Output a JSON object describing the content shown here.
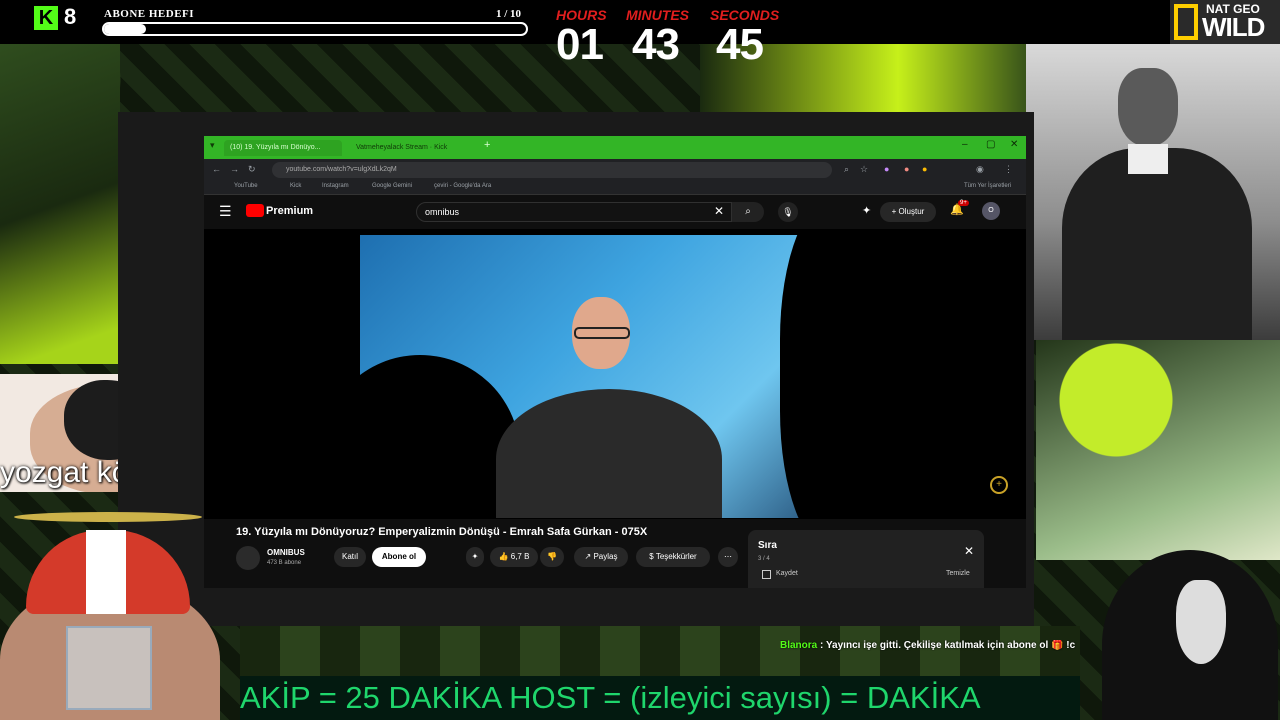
{
  "top_bar": {
    "kick_badge": "K",
    "kick_count": "8",
    "goal_title": "ABONE HEDEFI",
    "goal_count": "1 / 10",
    "goal_progress": 0.1,
    "timer": {
      "hours_label": "HOURS",
      "hours": "01",
      "minutes_label": "MINUTES",
      "minutes": "43",
      "seconds_label": "SECONDS",
      "seconds": "45"
    },
    "brand": {
      "line1": "NAT GEO",
      "line2": "WILD"
    }
  },
  "overlay": {
    "coal_label": "yozgat kömürü",
    "chat": {
      "user": "Blanora",
      "message": ": Yayıncı işe gitti. Çekilişe katılmak için abone ol 🎁 !c"
    },
    "ticker": "AKİP = 25 DAKİKA        HOST = (izleyici sayısı) = DAKİKA"
  },
  "browser": {
    "tabs": [
      "(10) 19. Yüzyıla mı Dönüyo...",
      "Vatmeheyalack Stream · Kick"
    ],
    "url": "youtube.com/watch?v=ulgXdLk2qM",
    "bookmarks": [
      "YouTube",
      "Kick",
      "Instagram",
      "Google Gemini",
      "çeviri - Google'da Ara",
      "Tüm Yer İşaretleri"
    ]
  },
  "youtube": {
    "logo_text": "Premium",
    "search_value": "omnibus",
    "create_label": "Oluştur",
    "notif_count": "9+",
    "avatar_letter": "O",
    "video_title": "19. Yüzyıla mı Dönüyoruz? Emperyalizmin Dönüşü - Emrah Safa Gürkan - 075X",
    "channel_name": "OMNIBUS",
    "channel_subs": "473 B abone",
    "join_label": "Katıl",
    "subscribe_label": "Abone ol",
    "like_count": "6,7 B",
    "share_label": "Paylaş",
    "thanks_label": "Teşekkürler",
    "queue": {
      "title": "Sıra",
      "position": "3 / 4",
      "save_label": "Kaydet",
      "clear_label": "Temizle"
    }
  }
}
